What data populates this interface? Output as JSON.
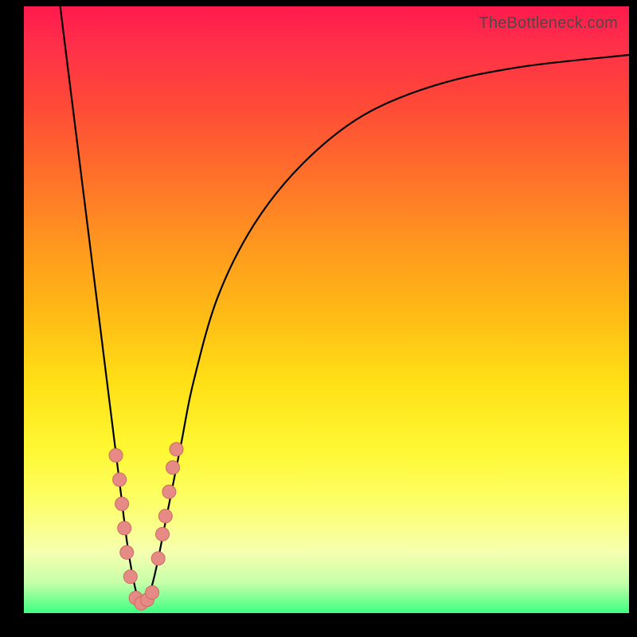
{
  "watermark": {
    "text": "TheBottleneck.com"
  },
  "colors": {
    "curve": "#000000",
    "dot_fill": "#e58a85",
    "dot_stroke": "#cf6a63",
    "background_black": "#000000"
  },
  "chart_data": {
    "type": "line",
    "title": "",
    "xlabel": "",
    "ylabel": "",
    "xlim": [
      0,
      100
    ],
    "ylim": [
      0,
      100
    ],
    "note": "Bottleneck-style V-curve. y≈100 means high (red/top), y≈0 means low (green/bottom). Minimum near x≈19.",
    "series": [
      {
        "name": "curve",
        "x": [
          6,
          8,
          10,
          12,
          14,
          15,
          16,
          17,
          18,
          19,
          20,
          21,
          22,
          23,
          24,
          26,
          28,
          32,
          38,
          46,
          56,
          68,
          82,
          100
        ],
        "y": [
          100,
          84,
          68,
          52,
          36,
          28,
          20,
          12,
          6,
          2,
          2,
          4,
          8,
          13,
          18,
          28,
          38,
          52,
          64,
          74,
          82,
          87,
          90,
          92
        ]
      }
    ],
    "points": [
      {
        "name": "left-cluster",
        "items": [
          {
            "x": 15.2,
            "y": 26
          },
          {
            "x": 15.8,
            "y": 22
          },
          {
            "x": 16.2,
            "y": 18
          },
          {
            "x": 16.6,
            "y": 14
          },
          {
            "x": 17.0,
            "y": 10
          },
          {
            "x": 17.6,
            "y": 6
          }
        ]
      },
      {
        "name": "valley-cluster",
        "items": [
          {
            "x": 18.5,
            "y": 2.5
          },
          {
            "x": 19.4,
            "y": 1.6
          },
          {
            "x": 20.4,
            "y": 2.2
          },
          {
            "x": 21.2,
            "y": 3.4
          }
        ]
      },
      {
        "name": "right-cluster",
        "items": [
          {
            "x": 22.2,
            "y": 9
          },
          {
            "x": 22.9,
            "y": 13
          },
          {
            "x": 23.4,
            "y": 16
          },
          {
            "x": 24.0,
            "y": 20
          },
          {
            "x": 24.6,
            "y": 24
          },
          {
            "x": 25.2,
            "y": 27
          }
        ]
      }
    ]
  }
}
